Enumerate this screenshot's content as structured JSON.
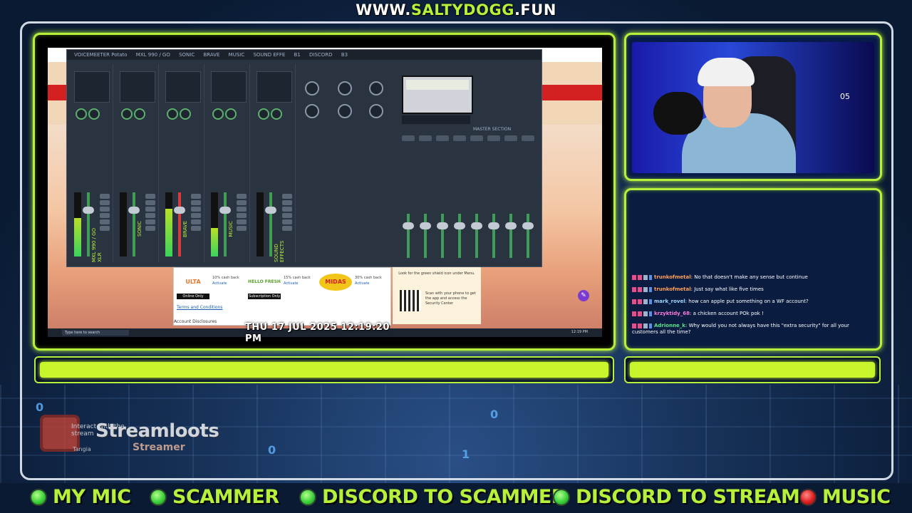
{
  "site": {
    "prefix": "WWW.",
    "accent": "SALTYDOGG",
    "suffix": ".FUN"
  },
  "colors": {
    "accent": "#b6f03a",
    "mic_on": "#3bd13b",
    "music_off": "#e01f1f"
  },
  "screen": {
    "datetime": "THU 17 JUL 2025 12:19:20 PM",
    "mixer": {
      "brand": "VOICEMEETER Potato",
      "strips": [
        {
          "name": "MXL 990 / GO",
          "label": "MXL 990 / GO XLR"
        },
        {
          "name": "SONIC",
          "label": "SONIC"
        },
        {
          "name": "BRAVE",
          "label": "BRAVE"
        },
        {
          "name": "MUSIC",
          "label": "MUSIC"
        },
        {
          "name": "SOUND EFFE",
          "label": "SOUND EFFECTS"
        }
      ],
      "busses": [
        "B1",
        "DISCORD",
        "B3"
      ],
      "master_section": "MASTER SECTION"
    },
    "promo": {
      "cards": [
        {
          "logo": "ULTA",
          "tag": "Online Only",
          "offer": "10% cash back"
        },
        {
          "logo": "HELLO FRESH",
          "tag": "Subscription Only",
          "offer": "15% cash back"
        },
        {
          "logo": "MIDAS",
          "tag": "",
          "offer": "30% cash back"
        }
      ],
      "activate": "Activate",
      "terms": "Terms and Conditions",
      "disclosures": "Account Disclosures",
      "security_head": "Look for the green shield icon under Menu.",
      "security_note": "Scan with your phone to get the app and access the Security Center"
    },
    "taskbar": {
      "search": "Type here to search",
      "time": "12:19 PM"
    }
  },
  "camera": {
    "clock": "05"
  },
  "chat": {
    "messages": [
      {
        "user": "trunkofmetal",
        "color": "#ff9f5a",
        "text": "No that doesn't make any sense but continue"
      },
      {
        "user": "trunkofmetal",
        "color": "#ff9f5a",
        "text": "Just say what like five times"
      },
      {
        "user": "mark_rovel",
        "color": "#9fd6ff",
        "text": "how can apple put something on a WF account?"
      },
      {
        "user": "krzyktidy_68",
        "color": "#ff7ad9",
        "text": "a chicken account POk pok !"
      },
      {
        "user": "Adrionne_k",
        "color": "#5be38a",
        "text": "Why would you not always have this \"extra security\" for all your customers all the time?"
      }
    ]
  },
  "streamloots": {
    "title": "Streamloots",
    "sub": "Streamer",
    "tiny": "Interact with the stream",
    "tiny2": "Tangia"
  },
  "status": [
    {
      "label": "MY MIC",
      "state": "on"
    },
    {
      "label": "SCAMMER",
      "state": "on"
    },
    {
      "label": "DISCORD TO SCAMMER",
      "state": "on"
    },
    {
      "label": "DISCORD TO STREAM",
      "state": "on"
    },
    {
      "label": "MUSIC",
      "state": "off"
    }
  ]
}
